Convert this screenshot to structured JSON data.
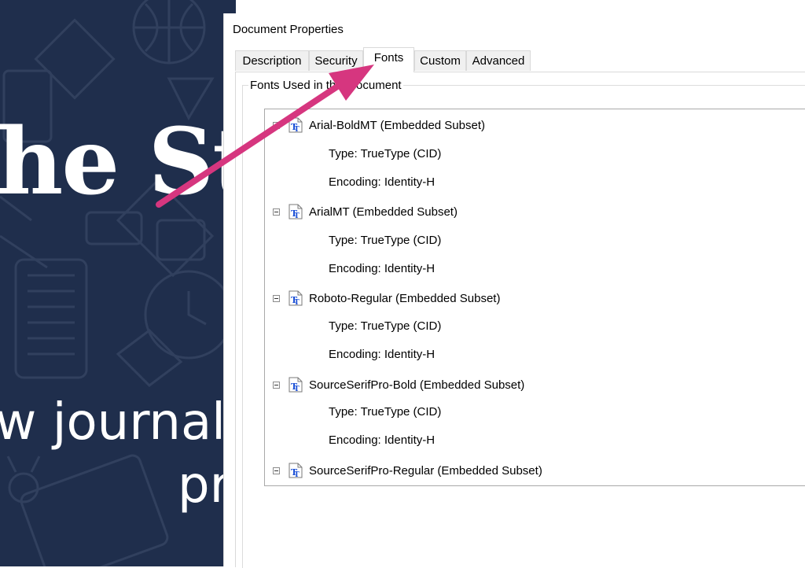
{
  "background_document": {
    "headline": "he St",
    "subline1": "w journali",
    "subline2": "pr"
  },
  "dialog": {
    "title": "Document Properties",
    "tabs": [
      {
        "label": "Description",
        "active": false
      },
      {
        "label": "Security",
        "active": false
      },
      {
        "label": "Fonts",
        "active": true
      },
      {
        "label": "Custom",
        "active": false
      },
      {
        "label": "Advanced",
        "active": false
      }
    ],
    "group_label": "Fonts Used in this Document",
    "fonts": [
      {
        "name": "Arial-BoldMT (Embedded Subset)",
        "type": "Type: TrueType (CID)",
        "encoding": "Encoding: Identity-H"
      },
      {
        "name": "ArialMT (Embedded Subset)",
        "type": "Type: TrueType (CID)",
        "encoding": "Encoding: Identity-H"
      },
      {
        "name": "Roboto-Regular (Embedded Subset)",
        "type": "Type: TrueType (CID)",
        "encoding": "Encoding: Identity-H"
      },
      {
        "name": "SourceSerifPro-Bold (Embedded Subset)",
        "type": "Type: TrueType (CID)",
        "encoding": "Encoding: Identity-H"
      },
      {
        "name": "SourceSerifPro-Regular (Embedded Subset)"
      }
    ]
  },
  "annotation": {
    "arrow_color": "#d6367f",
    "icon": "arrow-icon"
  },
  "colors": {
    "poster_bg": "#1f2e4c",
    "font_icon_blue": "#1b4fd6"
  }
}
